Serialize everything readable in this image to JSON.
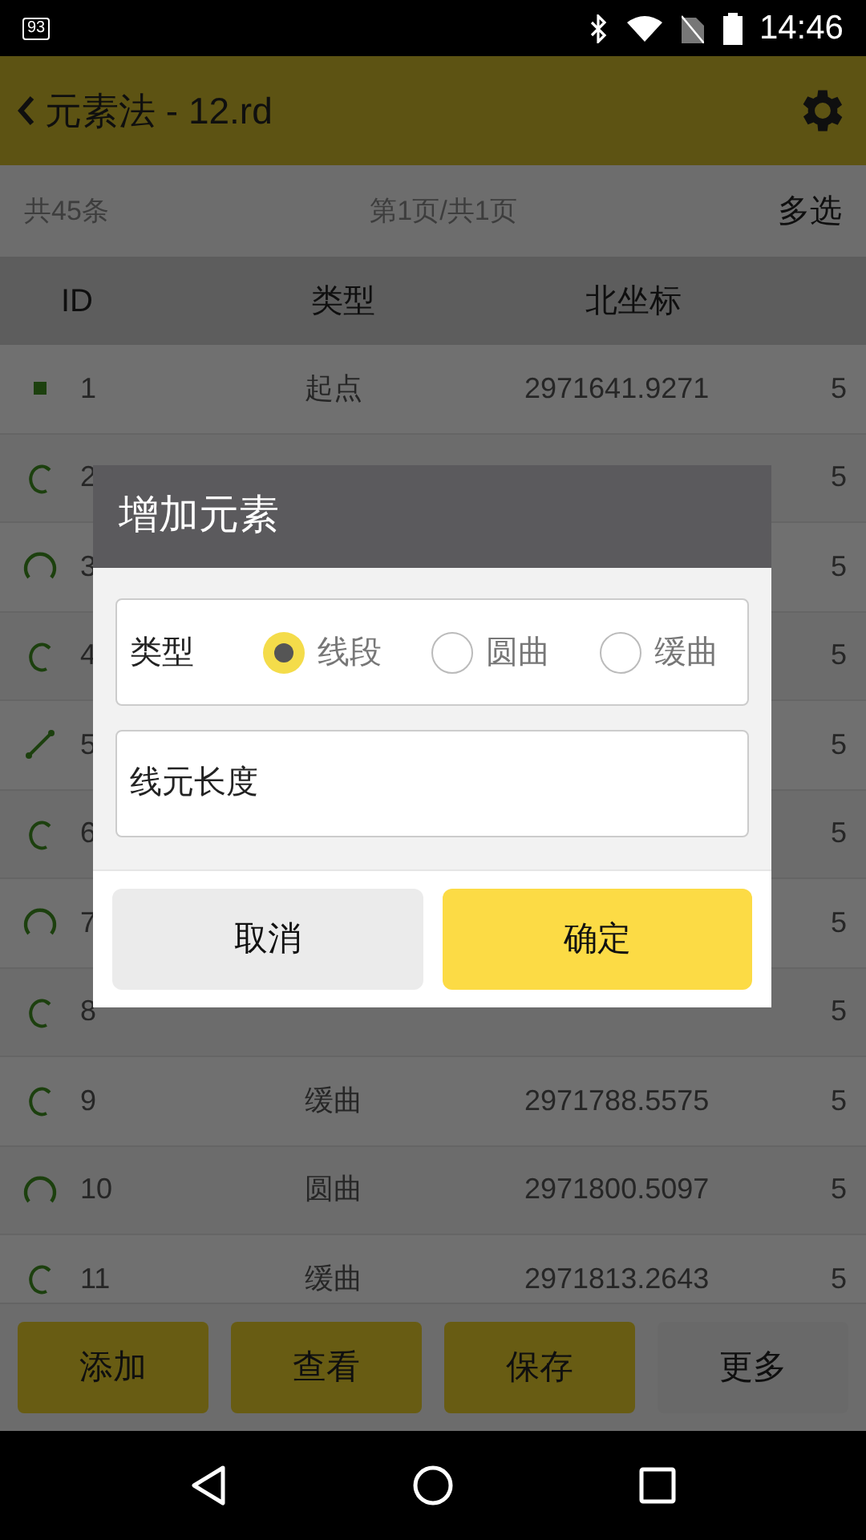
{
  "status_bar": {
    "battery_label": "93",
    "time": "14:46"
  },
  "header": {
    "title": "元素法 - 12.rd"
  },
  "info_bar": {
    "count": "共45条",
    "page": "第1页/共1页",
    "multi_select": "多选"
  },
  "table": {
    "columns": [
      "ID",
      "类型",
      "北坐标"
    ],
    "rows": [
      {
        "kind": "start",
        "id": "1",
        "type": "起点",
        "north": "2971641.9271",
        "column_4": "5"
      },
      {
        "kind": "spiral",
        "id": "2",
        "column_4": "5"
      },
      {
        "kind": "arc",
        "id": "3",
        "column_4": "5"
      },
      {
        "kind": "spiral",
        "id": "4",
        "column_4": "5"
      },
      {
        "kind": "line",
        "id": "5",
        "column_4": "5"
      },
      {
        "kind": "spiral",
        "id": "6",
        "column_4": "5"
      },
      {
        "kind": "arc",
        "id": "7",
        "column_4": "5"
      },
      {
        "kind": "spiral",
        "id": "8",
        "column_4": "5"
      },
      {
        "kind": "spiral",
        "id": "9",
        "type": "缓曲",
        "north": "2971788.5575",
        "column_4": "5"
      },
      {
        "kind": "arc",
        "id": "10",
        "type": "圆曲",
        "north": "2971800.5097",
        "column_4": "5"
      },
      {
        "kind": "spiral",
        "id": "11",
        "type": "缓曲",
        "north": "2971813.2643",
        "column_4": "5"
      }
    ]
  },
  "bottom_buttons": [
    {
      "label": "添加",
      "kind": "primary"
    },
    {
      "label": "查看",
      "kind": "primary"
    },
    {
      "label": "保存",
      "kind": "primary"
    },
    {
      "label": "更多",
      "kind": "secondary"
    }
  ],
  "dialog": {
    "title": "增加元素",
    "type_label": "类型",
    "options": [
      {
        "label": "线段",
        "selected": true
      },
      {
        "label": "圆曲",
        "selected": false
      },
      {
        "label": "缓曲",
        "selected": false
      }
    ],
    "length_field": {
      "placeholder": "线元长度"
    },
    "buttons": [
      {
        "label": "取消",
        "kind": "cancel"
      },
      {
        "label": "确定",
        "kind": "confirm"
      }
    ]
  }
}
